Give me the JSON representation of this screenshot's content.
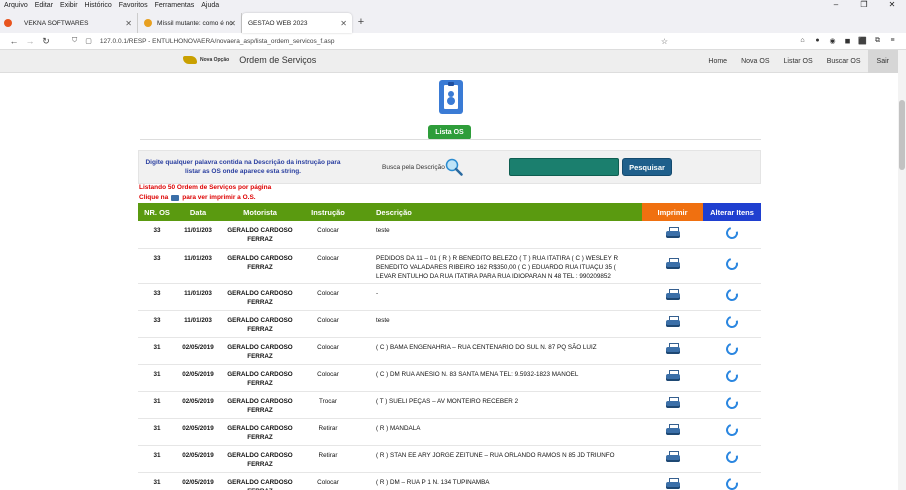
{
  "browser": {
    "menu": [
      "Arquivo",
      "Editar",
      "Exibir",
      "Histórico",
      "Favoritos",
      "Ferramentas",
      "Ajuda"
    ],
    "tabs": [
      {
        "label": "VEKNA SOFTWARES",
        "active": false
      },
      {
        "label": "Míssil mutante: como é nova ar...",
        "active": false
      },
      {
        "label": "GESTAO WEB 2023",
        "active": true
      }
    ],
    "url": "127.0.0.1/RESP - ENTULHONOVAERA/novaera_asp/lista_ordem_servicos_f.asp"
  },
  "header": {
    "brand_name": "Nova Opção",
    "title": "Ordem de Serviços",
    "nav": [
      "Home",
      "Nova OS",
      "Listar OS",
      "Buscar OS",
      "Sair"
    ]
  },
  "lista_button": "Lista OS",
  "search": {
    "hint": "Digite qualquer palavra contida na Descrição da instrução para listar as OS onde aparece esta string.",
    "label": "Busca pela Descrição",
    "value": "",
    "button": "Pesquisar"
  },
  "notices": {
    "listing": "Listando 50 Ordem de Serviços por página",
    "click_prefix": "Clique na",
    "click_suffix": "para ver imprimir a O.S."
  },
  "table": {
    "headers": [
      "NR. OS",
      "Data",
      "Motorista",
      "Instrução",
      "Descrição",
      "Imprimir",
      "Alterar Itens"
    ],
    "rows": [
      {
        "nr": "33",
        "data": "11/01/203",
        "motorista": "GERALDO CARDOSO FERRAZ",
        "instrucao": "Colocar",
        "descricao": "teste"
      },
      {
        "nr": "33",
        "data": "11/01/203",
        "motorista": "GERALDO CARDOSO FERRAZ",
        "instrucao": "Colocar",
        "descricao": "PEDIDOS DA 11 – 01 ( R ) R BENEDITO BELEZO ( T ) RUA ITATIRA ( C ) WESLEY R BENEDITO VALADARES RIBEIRO 162 R$350,00 ( C ) EDUARDO RUA ITUAÇU 35 ( LEVAR ENTULHO DA RUA ITATIRA PARA RUA IDIOPARAN N 48 TEL : 990209852"
      },
      {
        "nr": "33",
        "data": "11/01/203",
        "motorista": "GERALDO CARDOSO FERRAZ",
        "instrucao": "Colocar",
        "descricao": "-"
      },
      {
        "nr": "33",
        "data": "11/01/203",
        "motorista": "GERALDO CARDOSO FERRAZ",
        "instrucao": "Colocar",
        "descricao": "teste"
      },
      {
        "nr": "31",
        "data": "02/05/2019",
        "motorista": "GERALDO CARDOSO FERRAZ",
        "instrucao": "Colocar",
        "descricao": "( C ) BAMA ENGENAHRIA – RUA CENTENARIO DO SUL N. 87 PQ SÃO LUIZ"
      },
      {
        "nr": "31",
        "data": "02/05/2019",
        "motorista": "GERALDO CARDOSO FERRAZ",
        "instrucao": "Colocar",
        "descricao": "( C ) DM RUA ANESIO N. 83 SANTA MENA TEL: 9.5932-1823 MANOEL"
      },
      {
        "nr": "31",
        "data": "02/05/2019",
        "motorista": "GERALDO CARDOSO FERRAZ",
        "instrucao": "Trocar",
        "descricao": "( T ) SUELI PEÇAS – AV MONTEIRO RECEBER 2"
      },
      {
        "nr": "31",
        "data": "02/05/2019",
        "motorista": "GERALDO CARDOSO FERRAZ",
        "instrucao": "Retirar",
        "descricao": "( R ) MANDALA"
      },
      {
        "nr": "31",
        "data": "02/05/2019",
        "motorista": "GERALDO CARDOSO FERRAZ",
        "instrucao": "Retirar",
        "descricao": "( R ) STAN EE ARY JORGE ZEITUNE – RUA ORLANDO RAMOS N 85 JD TRIUNFO"
      },
      {
        "nr": "31",
        "data": "02/05/2019",
        "motorista": "GERALDO CARDOSO FERRAZ",
        "instrucao": "Colocar",
        "descricao": "( R ) DM – RUA P 1 N. 134 TUPINAMBA"
      }
    ]
  },
  "colors": {
    "header_green": "#5a9a10",
    "print_orange": "#f07010",
    "alter_blue": "#1f3fd0",
    "button_green": "#2e9d3a"
  }
}
